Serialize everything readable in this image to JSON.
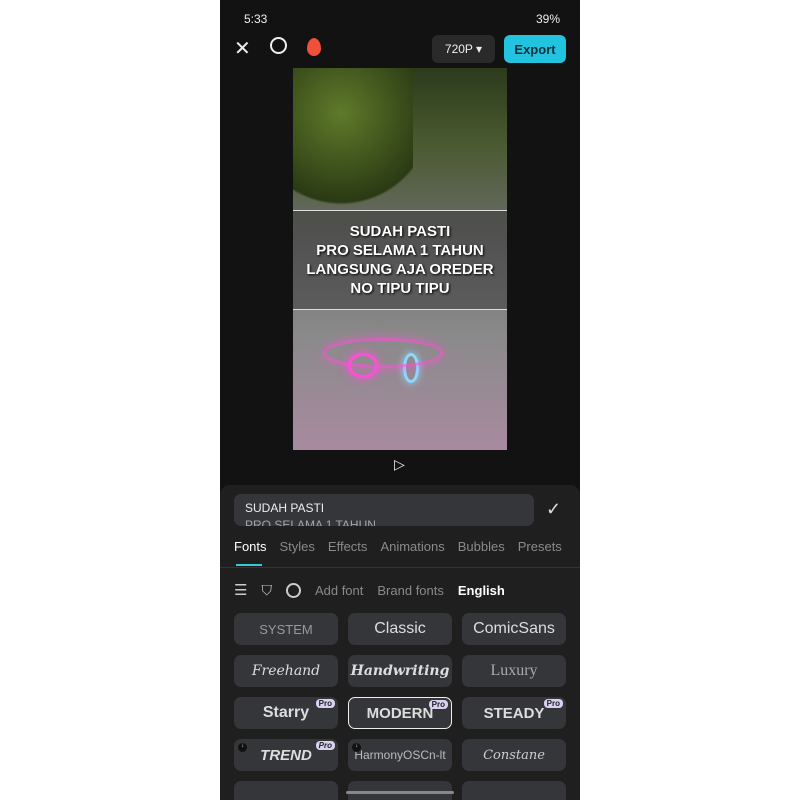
{
  "status": {
    "time": "5:33",
    "right": "39%"
  },
  "topbar": {
    "resolution": "720P ▾",
    "export": "Export"
  },
  "video": {
    "caption_lines": [
      "SUDAH PASTI",
      "PRO SELAMA 1 TAHUN",
      "LANGSUNG AJA OREDER",
      "NO TIPU TIPU"
    ]
  },
  "editor": {
    "text_value_line1": "SUDAH PASTI",
    "text_value_line2": "PRO SELAMA 1 TAHUN"
  },
  "tabs": [
    "Fonts",
    "Styles",
    "Effects",
    "Animations",
    "Bubbles",
    "Presets"
  ],
  "tools": {
    "add_font": "Add font",
    "brand_fonts": "Brand fonts",
    "english": "English"
  },
  "fonts": [
    {
      "label": "SYSTEM"
    },
    {
      "label": "Classic"
    },
    {
      "label": "ComicSans"
    },
    {
      "label": "Freehand"
    },
    {
      "label": "Handwriting"
    },
    {
      "label": "Luxury"
    },
    {
      "label": "Starry",
      "pro": "Pro"
    },
    {
      "label": "MODERN",
      "pro": "Pro",
      "selected": true
    },
    {
      "label": "STEADY",
      "pro": "Pro"
    },
    {
      "label": "TREND",
      "pro": "Pro"
    },
    {
      "label": "HarmonyOSCn-lt"
    },
    {
      "label": "Constane"
    }
  ],
  "colors": {
    "accent": "#22c3df",
    "background": "#121212",
    "panel": "#1f1f1f"
  }
}
